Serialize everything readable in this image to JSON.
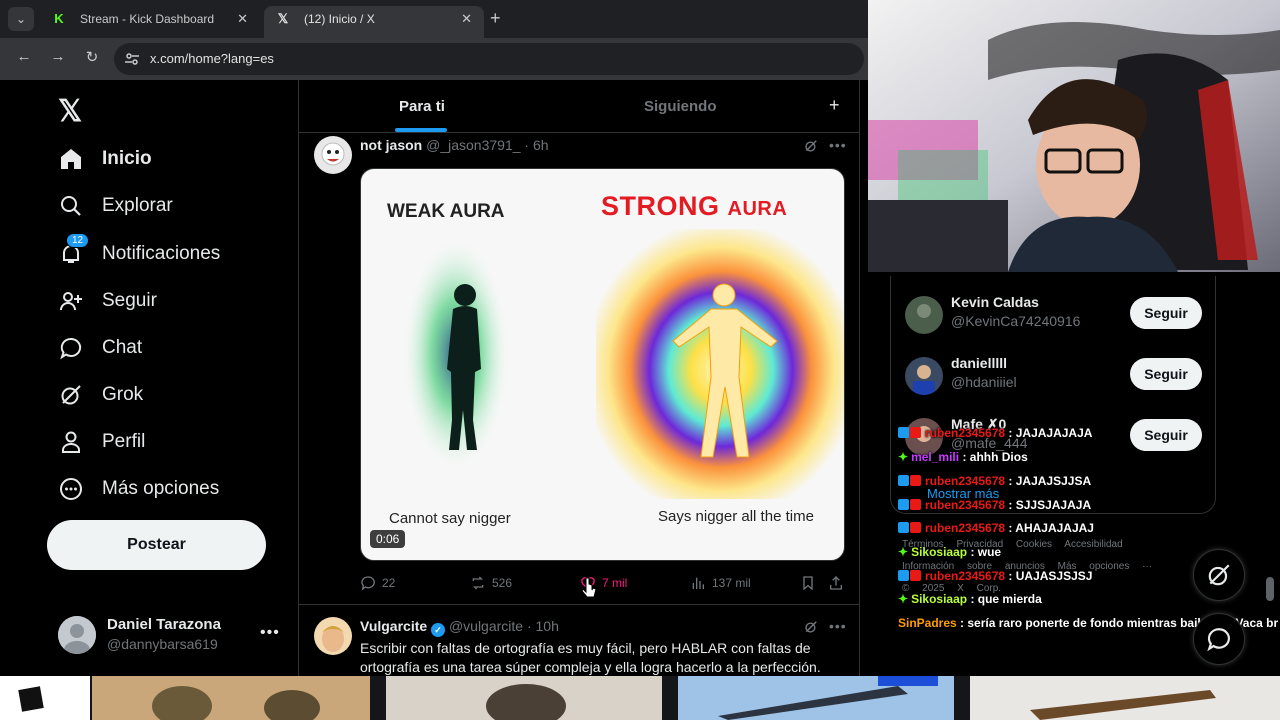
{
  "browser": {
    "tabs": [
      {
        "label": "Stream - Kick Dashboard",
        "favicon": "kick-icon",
        "color": "#53fc18"
      },
      {
        "label": "(12) Inicio / X",
        "favicon": "x-icon"
      }
    ],
    "url": "x.com/home?lang=es"
  },
  "nav": {
    "items": [
      {
        "label": "Inicio",
        "icon": "home-icon"
      },
      {
        "label": "Explorar",
        "icon": "search-icon"
      },
      {
        "label": "Notificaciones",
        "icon": "bell-icon",
        "badge": "12"
      },
      {
        "label": "Seguir",
        "icon": "follow-icon"
      },
      {
        "label": "Chat",
        "icon": "chat-icon"
      },
      {
        "label": "Grok",
        "icon": "grok-icon"
      },
      {
        "label": "Perfil",
        "icon": "person-icon"
      },
      {
        "label": "Más opciones",
        "icon": "more-icon"
      }
    ],
    "post_label": "Postear",
    "profile": {
      "name": "Daniel Tarazona",
      "handle": "@dannybarsa619"
    }
  },
  "timeline": {
    "tabs": [
      "Para ti",
      "Siguiendo"
    ],
    "post1": {
      "name": "not jason",
      "meta": "@_jason3791_ · 6h",
      "media": {
        "left_title": "WEAK AURA",
        "right_title": "STRONG",
        "right_title_suffix": "AURA",
        "left_caption": "Cannot say nigger",
        "right_caption": "Says nigger all the time",
        "duration": "0:06"
      },
      "stats": {
        "replies": "22",
        "reposts": "526",
        "likes": "7 mil",
        "views": "137 mil"
      }
    },
    "post2": {
      "name": "Vulgarcite",
      "meta": "@vulgarcite · 10h",
      "text": "Escribir con faltas de ortografía es muy fácil, pero HABLAR con faltas de ortografía es una tarea súper compleja y ella logra hacerlo a la perfección."
    }
  },
  "suggestions": [
    {
      "name": "Kevin Caldas",
      "handle": "@KevinCa74240916",
      "button": "Seguir"
    },
    {
      "name": "danielllll",
      "handle": "@hdaniiiel",
      "button": "Seguir"
    },
    {
      "name": "Mafe ✗0",
      "handle": "@mafe_444",
      "button": "Seguir"
    }
  ],
  "show_more": "Mostrar más",
  "footer": {
    "line1": "Términos  Privacidad  Cookies  Accesibilidad",
    "line2": "Información sobre anuncios  Más opciones ···",
    "line3": "© 2025 X Corp."
  },
  "chat": [
    {
      "user": "ruben2345678",
      "text": ": JAJAJAJAJA",
      "color": "#e91916",
      "badges": true
    },
    {
      "user": "mel_mili",
      "text": ": ahhh Dios",
      "color": "#c33cff",
      "badges": false
    },
    {
      "user": "ruben2345678",
      "text": ": JAJAJSJJSA",
      "color": "#e91916",
      "badges": true
    },
    {
      "user": "ruben2345678",
      "text": ": SJJSJAJAJA",
      "color": "#e91916",
      "badges": true
    },
    {
      "user": "ruben2345678",
      "text": ": AHAJAJAJAJ",
      "color": "#e91916",
      "badges": true
    },
    {
      "user": "Sikosiaap",
      "text": ": wue",
      "color": "#b8ff3a",
      "badges": false
    },
    {
      "user": "ruben2345678",
      "text": ": UAJASJSJSJ",
      "color": "#e91916",
      "badges": true
    },
    {
      "user": "Sikosiaap",
      "text": ": que mierda",
      "color": "#b8ff3a",
      "badges": false
    },
    {
      "user": "SinPadres",
      "text": ": sería raro ponerte de fondo mientras bailan La Vaca br",
      "color": "#ff9d00",
      "badges": false
    }
  ],
  "colors": {
    "accent": "#1d9bf0",
    "like": "#f91880",
    "kick": "#53fc18"
  }
}
